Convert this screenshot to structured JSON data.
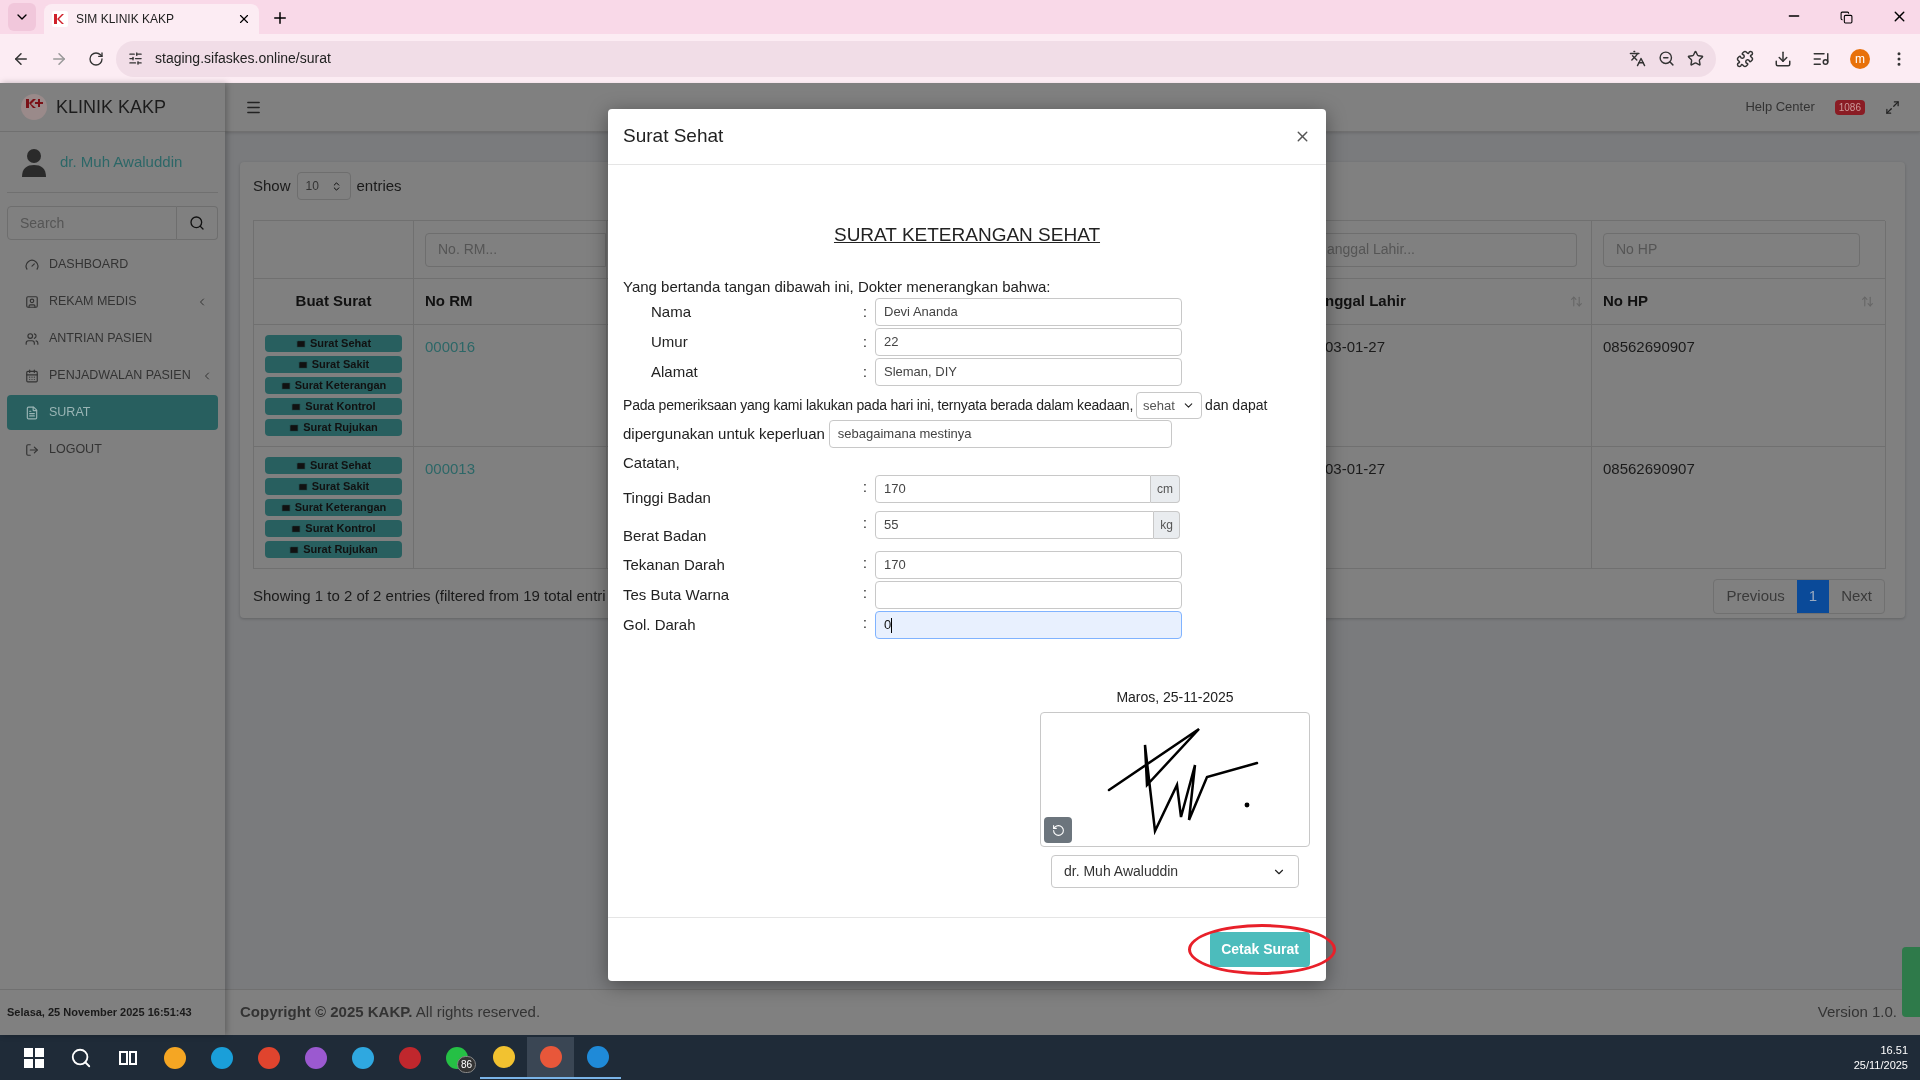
{
  "browser": {
    "tab_title": "SIM KLINIK KAKP",
    "url": "staging.sifaskes.online/surat",
    "profile": "m"
  },
  "sidebar": {
    "brand": "KLINIK KAKP",
    "user": "dr. Muh Awaluddin",
    "search_placeholder": "Search",
    "items": [
      {
        "label": "DASHBOARD",
        "has_submenu": false,
        "selected": false
      },
      {
        "label": "REKAM MEDIS",
        "has_submenu": true,
        "selected": false
      },
      {
        "label": "ANTRIAN PASIEN",
        "has_submenu": false,
        "selected": false
      },
      {
        "label": "PENJADWALAN PASIEN",
        "has_submenu": true,
        "selected": false
      },
      {
        "label": "SURAT",
        "has_submenu": false,
        "selected": true
      },
      {
        "label": "LOGOUT",
        "has_submenu": false,
        "selected": false
      }
    ],
    "datetime": "Selasa, 25 November 2025 16:51:43"
  },
  "header": {
    "help": "Help Center",
    "badge": "1086"
  },
  "table": {
    "show_label": "Show",
    "page_size": "10",
    "entries_label": "entries",
    "filters": [
      "No. RM...",
      "anggal Lahir...",
      "No HP"
    ],
    "columns": [
      {
        "label": "Buat Surat",
        "sortable": false
      },
      {
        "label": "No RM",
        "sortable": false
      },
      {
        "label": "nggal Lahir",
        "sortable": true
      },
      {
        "label": "No HP",
        "sortable": true
      }
    ],
    "rows": [
      {
        "actions": [
          "Surat Sehat",
          "Surat Sakit",
          "Surat Keterangan",
          "Surat Kontrol",
          "Surat Rujukan"
        ],
        "no_rm": "000016",
        "column_3": "03-01-27",
        "no_hp": "08562690907"
      },
      {
        "actions": [
          "Surat Sehat",
          "Surat Sakit",
          "Surat Keterangan",
          "Surat Kontrol",
          "Surat Rujukan"
        ],
        "no_rm": "000013",
        "column_3": "03-01-27",
        "no_hp": "08562690907"
      }
    ],
    "info": "Showing 1 to 2 of 2 entries (filtered from 19 total entri",
    "pagination": [
      {
        "label": "Previous",
        "selected": false
      },
      {
        "label": "1",
        "selected": true
      },
      {
        "label": "Next",
        "selected": false
      }
    ]
  },
  "footer": {
    "copyright": "**Copyright © 2025 KAKP.** All rights reserved.",
    "version": "Version 1.0."
  },
  "modal": {
    "title": "Surat Sehat",
    "heading": "SURAT KETERANGAN SEHAT",
    "intro": "Yang bertanda tangan dibawah ini, Dokter menerangkan bahwa:",
    "identity": [
      {
        "label": "Nama",
        "separator": ":",
        "value": "Devi Ananda"
      },
      {
        "label": "Umur",
        "separator": ":",
        "value": "22"
      },
      {
        "label": "Alamat",
        "separator": ":",
        "value": "Sleman, DIY"
      }
    ],
    "statement_1": "Pada pemeriksaan yang kami lakukan pada hari ini, ternyata berada dalam keadaan,",
    "condition": "sehat",
    "statement_2": "dan dapat",
    "statement_3": "dipergunakan untuk keperluan",
    "purpose": "sebagaimana mestinya",
    "notes_label": "Catatan,",
    "notes": [
      {
        "label": "Tinggi Badan",
        "separator": ":",
        "value": "170",
        "unit": "cm",
        "focused": false
      },
      {
        "label": "Berat Badan",
        "separator": ":",
        "value": "55",
        "unit": "kg",
        "focused": false
      },
      {
        "label": "Tekanan Darah",
        "separator": ":",
        "value": "170",
        "focused": false
      },
      {
        "label": "Tes Buta Warna",
        "separator": ":",
        "focused": false
      },
      {
        "label": "Gol. Darah",
        "separator": ":",
        "value": "0",
        "focused": true
      }
    ],
    "place_date": "Maros, 25-11-2025",
    "doctor": "dr. Muh Awaluddin",
    "print_button": {
      "label": "Cetak Surat",
      "highlighted": true
    }
  },
  "taskbar": {
    "apps": [
      {
        "kind": "start",
        "active": false
      },
      {
        "kind": "search",
        "active": false
      },
      {
        "kind": "task_view",
        "active": false
      },
      {
        "kind": "app",
        "color": "#f5a623",
        "active": false
      },
      {
        "kind": "app",
        "color": "#1a9fd9",
        "active": false
      },
      {
        "kind": "app",
        "color": "#e0442e",
        "active": false
      },
      {
        "kind": "app",
        "color": "#9b59d0",
        "active": false
      },
      {
        "kind": "app",
        "color": "#2fa8e0",
        "active": false
      },
      {
        "kind": "app",
        "color": "#c0272d",
        "active": false
      },
      {
        "kind": "app",
        "color": "#25c045",
        "badge": "86",
        "active": false
      },
      {
        "kind": "app",
        "color": "#f2c230",
        "active": true
      },
      {
        "kind": "app",
        "color": "#e8573a",
        "active": true
      },
      {
        "kind": "app",
        "color": "#1f8ad8",
        "active": true
      }
    ],
    "time": "16.51",
    "date": "25/11/2025"
  }
}
